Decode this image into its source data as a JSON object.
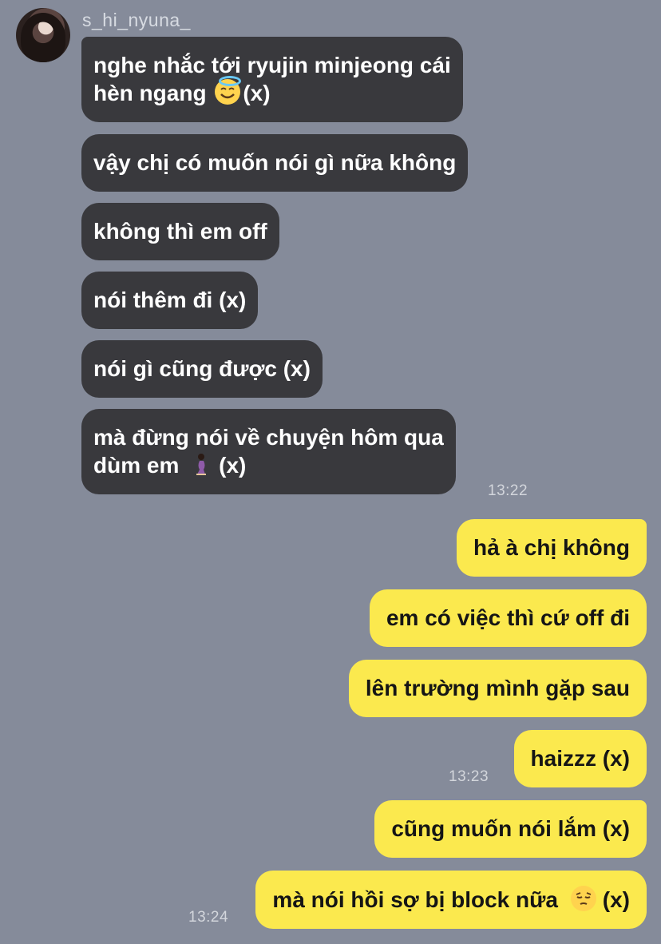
{
  "sender": {
    "username": "s_hi_nyuna_"
  },
  "incoming": [
    {
      "line1": "nghe nhắc tới ryujin minjeong cái",
      "line2_pre": "hèn ngang ",
      "line2_post": "(x)"
    },
    {
      "text": "vậy chị có muốn nói gì nữa không"
    },
    {
      "text": "không thì em off"
    },
    {
      "text": "nói thêm đi (x)"
    },
    {
      "text": "nói gì cũng được (x)"
    },
    {
      "line1": "mà đừng nói về chuyện hôm qua",
      "line2_pre": "dùm em ",
      "line2_post": "(x)"
    }
  ],
  "outgoing": [
    {
      "text": "hả à chị không"
    },
    {
      "text": "em có việc thì cứ off đi"
    },
    {
      "text": "lên trường mình gặp sau"
    },
    {
      "text": "haizzz (x)"
    },
    {
      "text": "cũng muốn nói lắm (x)"
    },
    {
      "text_pre": "mà nói hồi sợ bị block nữa ",
      "text_post": "(x)"
    }
  ],
  "timestamps": {
    "t1": "13:22",
    "t2": "13:23",
    "t3": "13:24"
  },
  "emoji": {
    "e1": "smiling-face-with-halo",
    "e2": "person-kneeling",
    "e3": "pensive-face"
  },
  "colors": {
    "background": "#858b9a",
    "incoming_bubble": "#39393d",
    "outgoing_bubble": "#fbe94e"
  }
}
